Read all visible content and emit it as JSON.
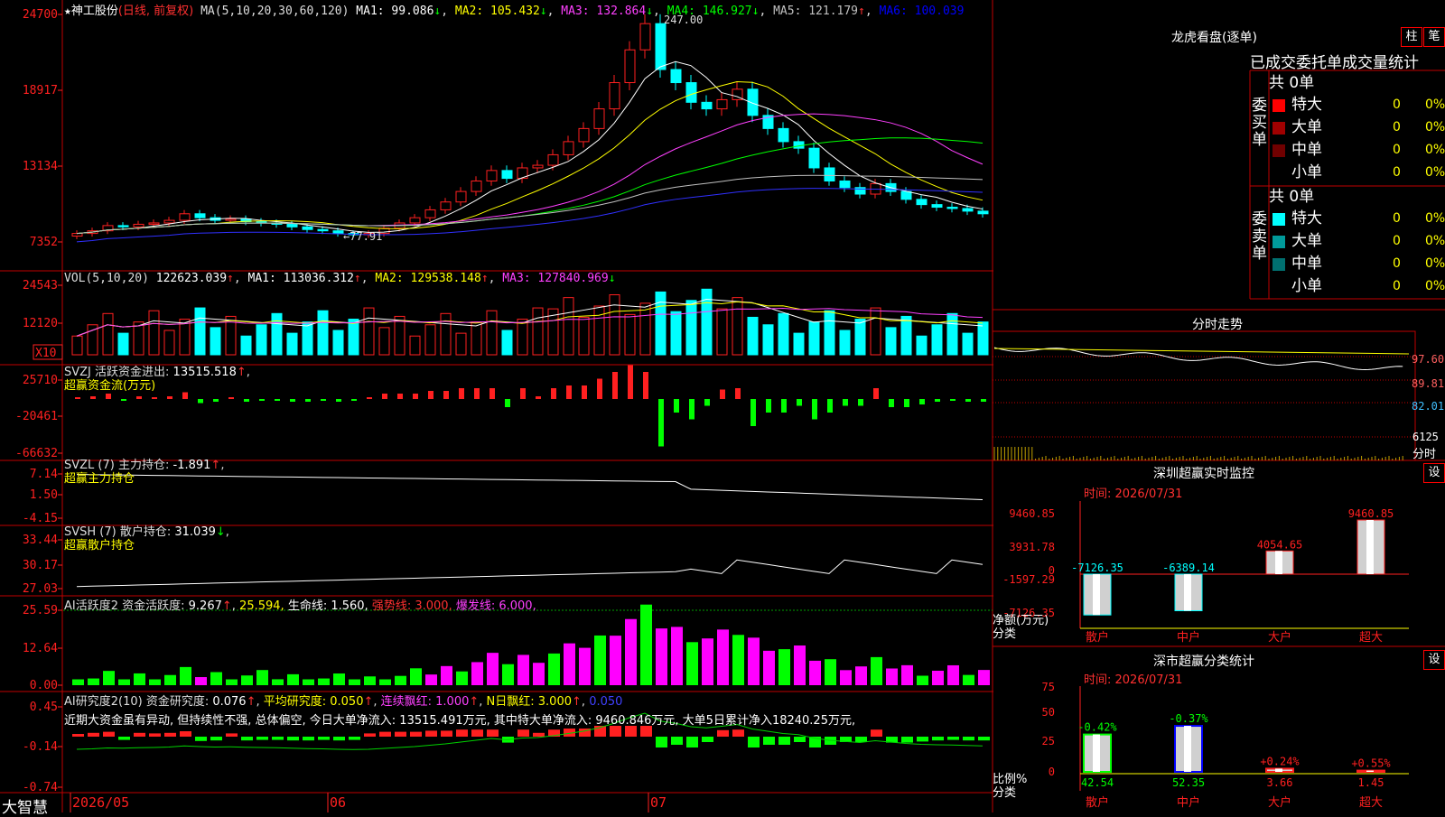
{
  "app": {
    "name": "大智慧"
  },
  "main": {
    "stock_name": "神工股份",
    "period_label": "(日线, 前复权)",
    "ma_header": "MA(5,10,20,30,60,120)",
    "ma_items": [
      {
        "label": "MA1:",
        "value": "99.086",
        "arrow": "↓",
        "color": "#ffffff"
      },
      {
        "label": "MA2:",
        "value": "105.432",
        "arrow": "↓",
        "color": "#ffff00"
      },
      {
        "label": "MA3:",
        "value": "132.864",
        "arrow": "↓",
        "color": "#ff40ff"
      },
      {
        "label": "MA4:",
        "value": "146.927",
        "arrow": "↓",
        "color": "#00ff00"
      },
      {
        "label": "MA5:",
        "value": "121.179",
        "arrow": "↑",
        "color": "#c0c0c0"
      },
      {
        "label": "MA6:",
        "value": "100.039",
        "arrow": "",
        "color": "#0000ff"
      }
    ],
    "y_axis": [
      "24700",
      "18917",
      "13134",
      "7352"
    ],
    "high_label": "247.00",
    "low_label": "77.91"
  },
  "vol": {
    "header": "VOL(5,10,20)",
    "value": "122623.039",
    "items": [
      {
        "label": "MA1:",
        "value": "113036.312",
        "color": "#ffffff"
      },
      {
        "label": "MA2:",
        "value": "129538.148",
        "color": "#ffff00"
      },
      {
        "label": "MA3:",
        "value": "127840.969",
        "color": "#ff40ff"
      }
    ],
    "y_axis": [
      "24543",
      "12120"
    ],
    "unit": "X10"
  },
  "svzj": {
    "header": "SVZJ  活跃资金进出:",
    "value": "13515.518",
    "sub": "超赢资金流(万元)",
    "y_axis": [
      "25710",
      "-20461",
      "-66632"
    ]
  },
  "svzl": {
    "header": "SVZL (7) 主力持仓:",
    "value": "-1.891",
    "sub": "超赢主力持仓",
    "y_axis": [
      "7.14",
      "1.50",
      "-4.15"
    ]
  },
  "svsh": {
    "header": "SVSH (7) 散户持仓:",
    "value": "31.039",
    "sub": "超赢散户持仓",
    "y_axis": [
      "33.44",
      "30.17",
      "27.03"
    ]
  },
  "ai1": {
    "header": "AI活跃度2 资金活跃度:",
    "value": "9.267",
    "v2": "25.594,",
    "life": "生命线: 1.560,",
    "strong": "强势线: 3.000,",
    "burst": "爆发线: 6.000,",
    "y_axis": [
      "25.59",
      "12.64",
      "0.00"
    ]
  },
  "ai2": {
    "header": "AI研究度2(10) 资金研究度:",
    "value": "0.076",
    "avg": "平均研究度: 0.050",
    "red": "连续飘红: 1.000",
    "nred": "N日飘红: 3.000",
    "last": "0.050",
    "comment": "近期大资金虽有异动, 但持续性不强, 总体偏空, 今日大单净流入: 13515.491万元, 其中特大单净流入: 9460.846万元, 大单5日累计净入18240.25万元,",
    "y_axis": [
      "0.45",
      "-0.14",
      "-0.74"
    ]
  },
  "xaxis": {
    "labels": [
      "2026/05",
      "06",
      "07"
    ]
  },
  "dragon": {
    "title": "龙虎看盘(逐单)",
    "btn1": "柱",
    "btn2": "笔",
    "subtitle": "已成交委托单成交量统计",
    "buy": {
      "side": "委买单",
      "total": "共 0单",
      "rows": [
        {
          "label": "特大",
          "count": "0",
          "pct": "0%",
          "color": "#ff0000"
        },
        {
          "label": "大单",
          "count": "0",
          "pct": "0%",
          "color": "#a00000"
        },
        {
          "label": "中单",
          "count": "0",
          "pct": "0%",
          "color": "#700000"
        },
        {
          "label": "小单",
          "count": "0",
          "pct": "0%",
          "color": ""
        }
      ]
    },
    "sell": {
      "side": "委卖单",
      "total": "共 0单",
      "rows": [
        {
          "label": "特大",
          "count": "0",
          "pct": "0%",
          "color": "#00ffff"
        },
        {
          "label": "大单",
          "count": "0",
          "pct": "0%",
          "color": "#009a9a"
        },
        {
          "label": "中单",
          "count": "0",
          "pct": "0%",
          "color": "#007070"
        },
        {
          "label": "小单",
          "count": "0",
          "pct": "0%",
          "color": ""
        }
      ]
    }
  },
  "intraday": {
    "title": "分时走势",
    "y_axis": [
      "97.60",
      "89.81",
      "82.01"
    ],
    "vol_label": "6125",
    "fen": "分时"
  },
  "monitor": {
    "title": "深圳超赢实时监控",
    "btn": "设",
    "time": "时间: 2026/07/31",
    "y_axis": [
      "9460.85",
      "3931.78",
      "0",
      "-1597.29",
      "-7126.35"
    ],
    "unit": "净额(万元)",
    "fenlei": "分类",
    "categories": [
      "散户",
      "中户",
      "大户",
      "超大"
    ],
    "values": [
      -7126.35,
      -6389.14,
      4054.65,
      9460.85
    ],
    "value_labels": [
      "-7126.35",
      "-6389.14",
      "4054.65",
      "9460.85"
    ]
  },
  "classify": {
    "title": "深市超赢分类统计",
    "btn": "设",
    "time": "时间: 2026/07/31",
    "y_axis": [
      "75",
      "50",
      "25",
      "0"
    ],
    "unit": "比例%",
    "fenlei": "分类",
    "categories": [
      "散户",
      "中户",
      "大户",
      "超大"
    ],
    "values": [
      42.54,
      52.35,
      3.66,
      1.45
    ],
    "value_labels": [
      "42.54",
      "52.35",
      "3.66",
      "1.45"
    ],
    "changes": [
      "-0.42%",
      "-0.37%",
      "+0.24%",
      "+0.55%"
    ]
  }
}
